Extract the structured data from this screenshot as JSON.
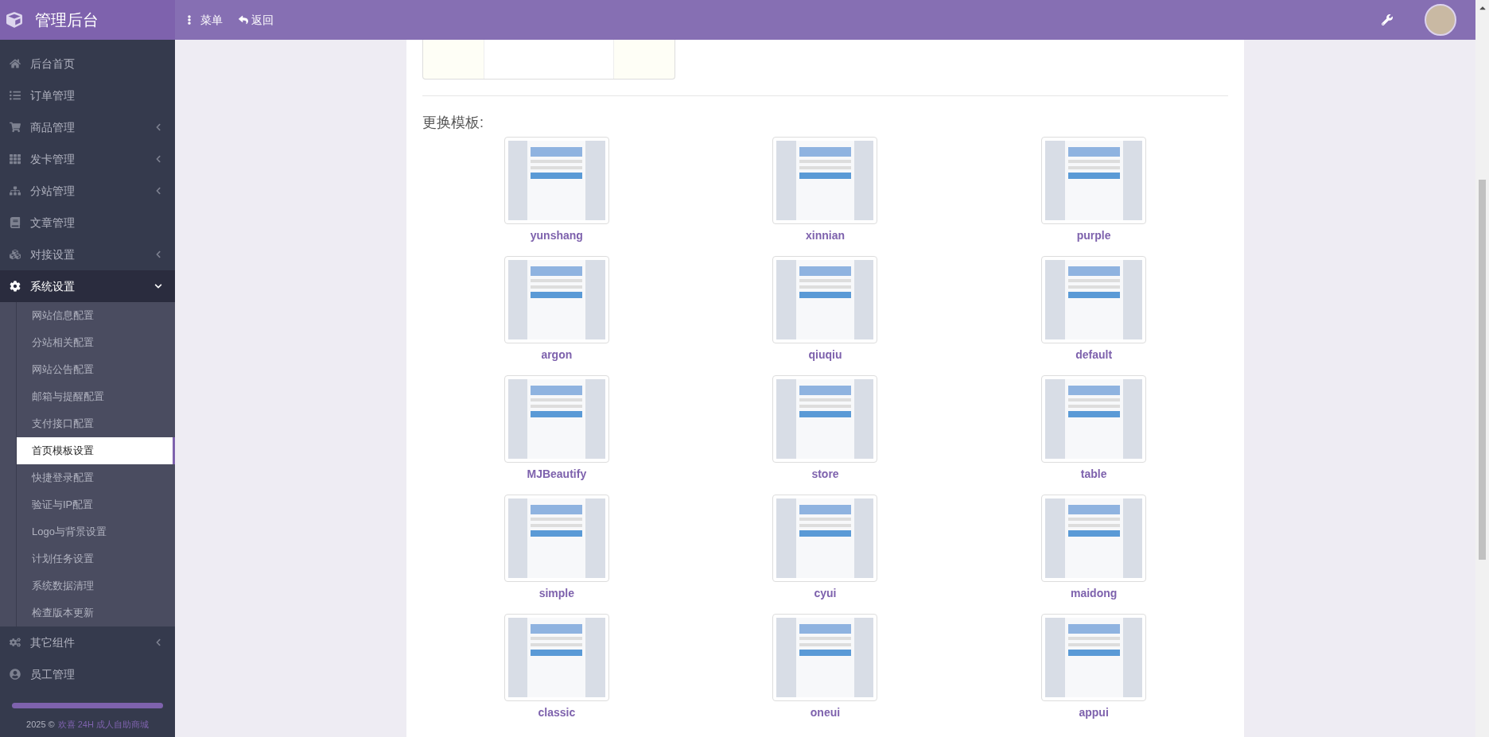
{
  "brand": {
    "title": "管理后台"
  },
  "topbar": {
    "menu": "菜单",
    "back": "返回"
  },
  "sidebar": {
    "items": [
      {
        "label": "后台首页",
        "kind": "link",
        "expanded": false
      },
      {
        "label": "订单管理",
        "kind": "link",
        "expanded": false
      },
      {
        "label": "商品管理",
        "kind": "group",
        "expanded": false
      },
      {
        "label": "发卡管理",
        "kind": "group",
        "expanded": false
      },
      {
        "label": "分站管理",
        "kind": "group",
        "expanded": false
      },
      {
        "label": "文章管理",
        "kind": "link",
        "expanded": false
      },
      {
        "label": "对接设置",
        "kind": "group",
        "expanded": false
      },
      {
        "label": "系统设置",
        "kind": "group",
        "expanded": true,
        "children": [
          {
            "label": "网站信息配置",
            "selected": false
          },
          {
            "label": "分站相关配置",
            "selected": false
          },
          {
            "label": "网站公告配置",
            "selected": false
          },
          {
            "label": "邮箱与提醒配置",
            "selected": false
          },
          {
            "label": "支付接口配置",
            "selected": false
          },
          {
            "label": "首页模板设置",
            "selected": true
          },
          {
            "label": "快捷登录配置",
            "selected": false
          },
          {
            "label": "验证与IP配置",
            "selected": false
          },
          {
            "label": "Logo与背景设置",
            "selected": false
          },
          {
            "label": "计划任务设置",
            "selected": false
          },
          {
            "label": "系统数据清理",
            "selected": false
          },
          {
            "label": "检查版本更新",
            "selected": false
          }
        ]
      },
      {
        "label": "其它组件",
        "kind": "group",
        "expanded": false
      },
      {
        "label": "员工管理",
        "kind": "link",
        "expanded": false
      }
    ],
    "footer": {
      "year": "2025 ©",
      "link": "欢喜 24H 成人自助商城"
    }
  },
  "content": {
    "section_title": "更换模板:",
    "templates": [
      {
        "name": "yunshang",
        "selected": false
      },
      {
        "name": "xinnian",
        "selected": false
      },
      {
        "name": "purple",
        "selected": false
      },
      {
        "name": "argon",
        "selected": false
      },
      {
        "name": "qiuqiu",
        "selected": false
      },
      {
        "name": "default",
        "selected": false
      },
      {
        "name": "MJBeautify",
        "selected": false
      },
      {
        "name": "store",
        "selected": false
      },
      {
        "name": "table",
        "selected": false
      },
      {
        "name": "simple",
        "selected": false
      },
      {
        "name": "cyui",
        "selected": false
      },
      {
        "name": "maidong",
        "selected": false
      },
      {
        "name": "classic",
        "selected": false
      },
      {
        "name": "oneui",
        "selected": false
      },
      {
        "name": "appui",
        "selected": false
      }
    ]
  }
}
